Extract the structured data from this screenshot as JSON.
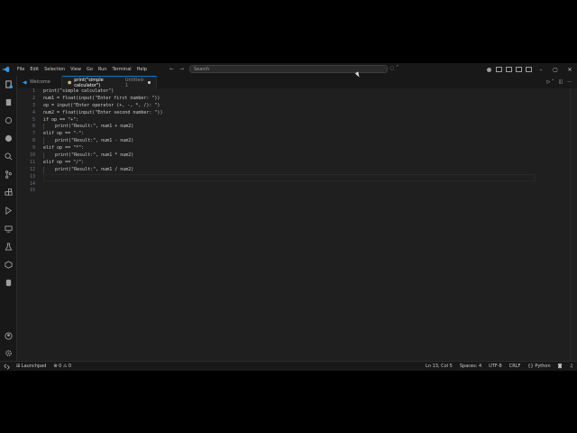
{
  "titlebar": {
    "menu": [
      "File",
      "Edit",
      "Selection",
      "View",
      "Go",
      "Run",
      "Terminal",
      "Help"
    ],
    "search_placeholder": "Search"
  },
  "tabs": [
    {
      "label": "Welcome",
      "active": false
    },
    {
      "label": "print(\"simple calculator\")",
      "subtitle": "Untitled-1",
      "active": true,
      "modified": true
    }
  ],
  "editor": {
    "line_numbers": [
      "1",
      "2",
      "3",
      "4",
      "5",
      "6",
      "7",
      "8",
      "9",
      "10",
      "11",
      "12",
      "13",
      "14",
      "15"
    ],
    "lines": [
      {
        "indent": 0,
        "text": "print(\"simple calculator\")"
      },
      {
        "indent": 0,
        "text": "num1 = float(input(\"Enter first number: \"))"
      },
      {
        "indent": 0,
        "text": "op = input(\"Enter operator (+, -, *, /): \")"
      },
      {
        "indent": 0,
        "text": "num2 = float(input(\"Enter second number: \"))"
      },
      {
        "indent": 0,
        "text": "if op == \"+\":"
      },
      {
        "indent": 1,
        "text": "print(\"Result:\", num1 + num2)"
      },
      {
        "indent": 0,
        "text": "elif op == \"-\":"
      },
      {
        "indent": 1,
        "text": "print(\"Result:\", num1 - num2)"
      },
      {
        "indent": 0,
        "text": "elif op == \"*\":"
      },
      {
        "indent": 1,
        "text": "print(\"Result:\", num1 * num2)"
      },
      {
        "indent": 0,
        "text": "elif op == \"/\":"
      },
      {
        "indent": 1,
        "text": "print(\"Result:\", num1 / num2)"
      },
      {
        "indent": 0,
        "text": ""
      },
      {
        "indent": 0,
        "text": ""
      },
      {
        "indent": 0,
        "text": ""
      }
    ]
  },
  "statusbar": {
    "launchpad": "Launchpad",
    "problems": "0 ⚠ 0",
    "cursor": "Ln 13, Col 5",
    "spaces": "Spaces: 4",
    "encoding": "UTF-8",
    "eol": "CRLF",
    "language": "Python"
  },
  "colors": {
    "accent": "#0078d4",
    "background": "#1f1f1f",
    "chrome": "#181818"
  }
}
